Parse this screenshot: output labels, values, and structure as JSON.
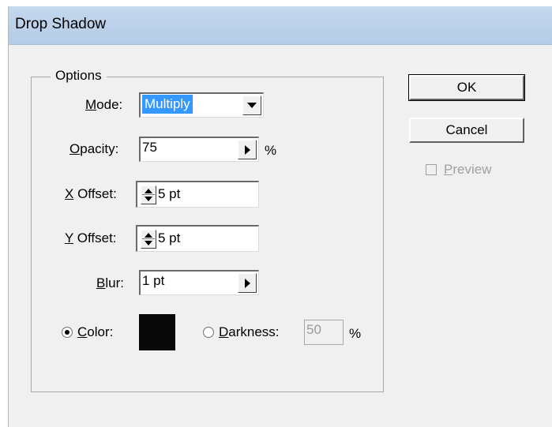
{
  "window": {
    "title": "Drop Shadow"
  },
  "options": {
    "legend": "Options",
    "mode": {
      "label": "Mode:",
      "mnemonic": "M",
      "rest": "ode:",
      "value": "Multiply"
    },
    "opacity": {
      "mnemonic": "O",
      "rest": "pacity:",
      "value": "75",
      "unit": "%"
    },
    "x_offset": {
      "mnemonic": "X",
      "rest": " Offset:",
      "value": "5 pt"
    },
    "y_offset": {
      "mnemonic": "Y",
      "rest": " Offset:",
      "value": "5 pt"
    },
    "blur": {
      "mnemonic": "B",
      "rest": "lur:",
      "value": "1 pt"
    },
    "color": {
      "mnemonic": "C",
      "rest": "olor:",
      "selected": true,
      "swatch_color": "#080808"
    },
    "darkness": {
      "mnemonic": "D",
      "rest": "arkness:",
      "value": "50",
      "unit": "%",
      "selected": false
    }
  },
  "buttons": {
    "ok": "OK",
    "cancel": "Cancel"
  },
  "preview": {
    "mnemonic": "P",
    "rest": "review",
    "checked": false
  }
}
